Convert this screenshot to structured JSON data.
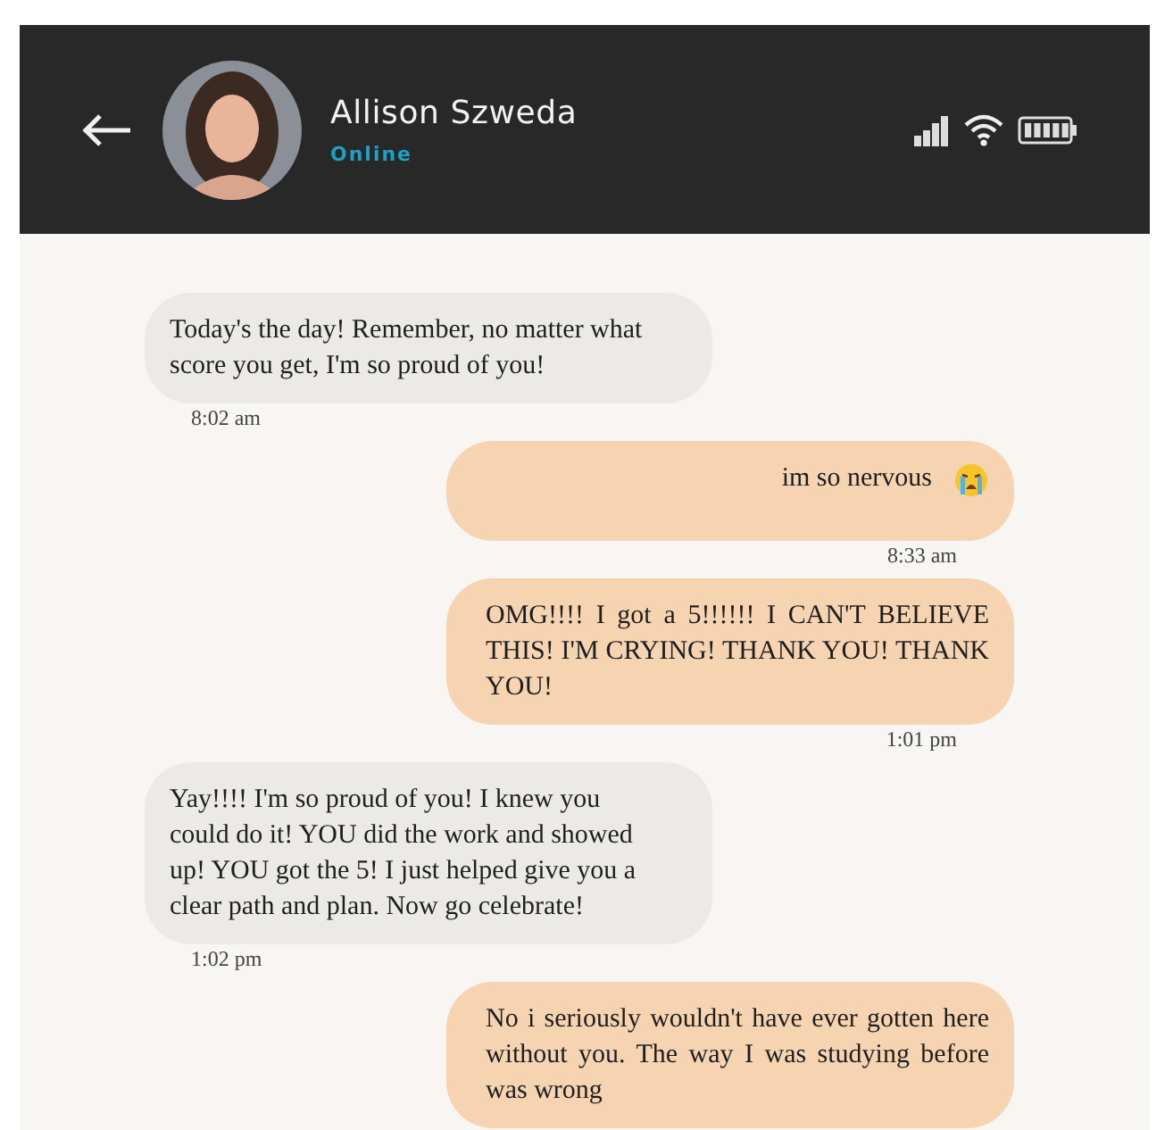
{
  "header": {
    "contact_name": "Allison Szweda",
    "status": "Online"
  },
  "messages": [
    {
      "kind": "received",
      "text": "Today's the day! Remember, no matter what score you get, I'm so proud of you!",
      "time": "8:02 am",
      "emoji": false
    },
    {
      "kind": "sent",
      "text": "im so nervous",
      "time": "8:33 am",
      "emoji": true
    },
    {
      "kind": "sent",
      "text": "OMG!!!! I got a 5!!!!!! I CAN'T BELIEVE THIS! I'M CRYING! THANK YOU! THANK YOU!",
      "time": "1:01 pm",
      "emoji": false
    },
    {
      "kind": "received",
      "text": "Yay!!!! I'm so proud of you! I knew you could do it! YOU did the work and showed up! YOU got the 5! I just helped give you a clear path and plan.  Now go celebrate!",
      "time": "1:02 pm",
      "emoji": false
    },
    {
      "kind": "sent",
      "text": "No i seriously wouldn't have ever gotten here without you. The way I was studying before was wrong",
      "emoji": false
    }
  ]
}
